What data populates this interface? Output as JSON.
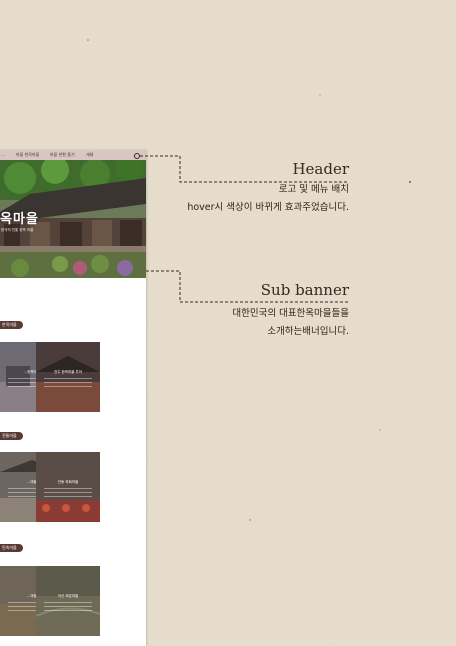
{
  "mockup": {
    "nav": [
      "...",
      "마을 한옥마을",
      "마을 한편 즐기",
      "게재"
    ],
    "banner": {
      "title": "옥마을",
      "subtitle": "한국의 전통 한옥 마을"
    },
    "sections": [
      {
        "tag": "한옥마을"
      },
      {
        "tag": "전통마을"
      },
      {
        "tag": "민속마을"
      }
    ],
    "cards": [
      {
        "title": "...한옥마을"
      },
      {
        "title": "전주 한옥마을 투어"
      },
      {
        "title": "...마을"
      },
      {
        "title": "안동 하회마을"
      },
      {
        "title": "...마을"
      },
      {
        "title": "아산 외암마을"
      }
    ]
  },
  "annotations": {
    "header": {
      "title": "Header",
      "desc_line1": "로고 및 메뉴 배치",
      "desc_line2": "hover시 색상이 바뀌게 효과주었습니다."
    },
    "sub_banner": {
      "title": "Sub banner",
      "desc_line1": "대한민국의 대표한옥마을들을",
      "desc_line2": "소개하는배너입니다."
    }
  },
  "colors": {
    "paper": "#e9e0d0",
    "accent_brown": "#5a3a35",
    "header_pink": "#d9c6c2",
    "text_dark": "#3b2723"
  }
}
